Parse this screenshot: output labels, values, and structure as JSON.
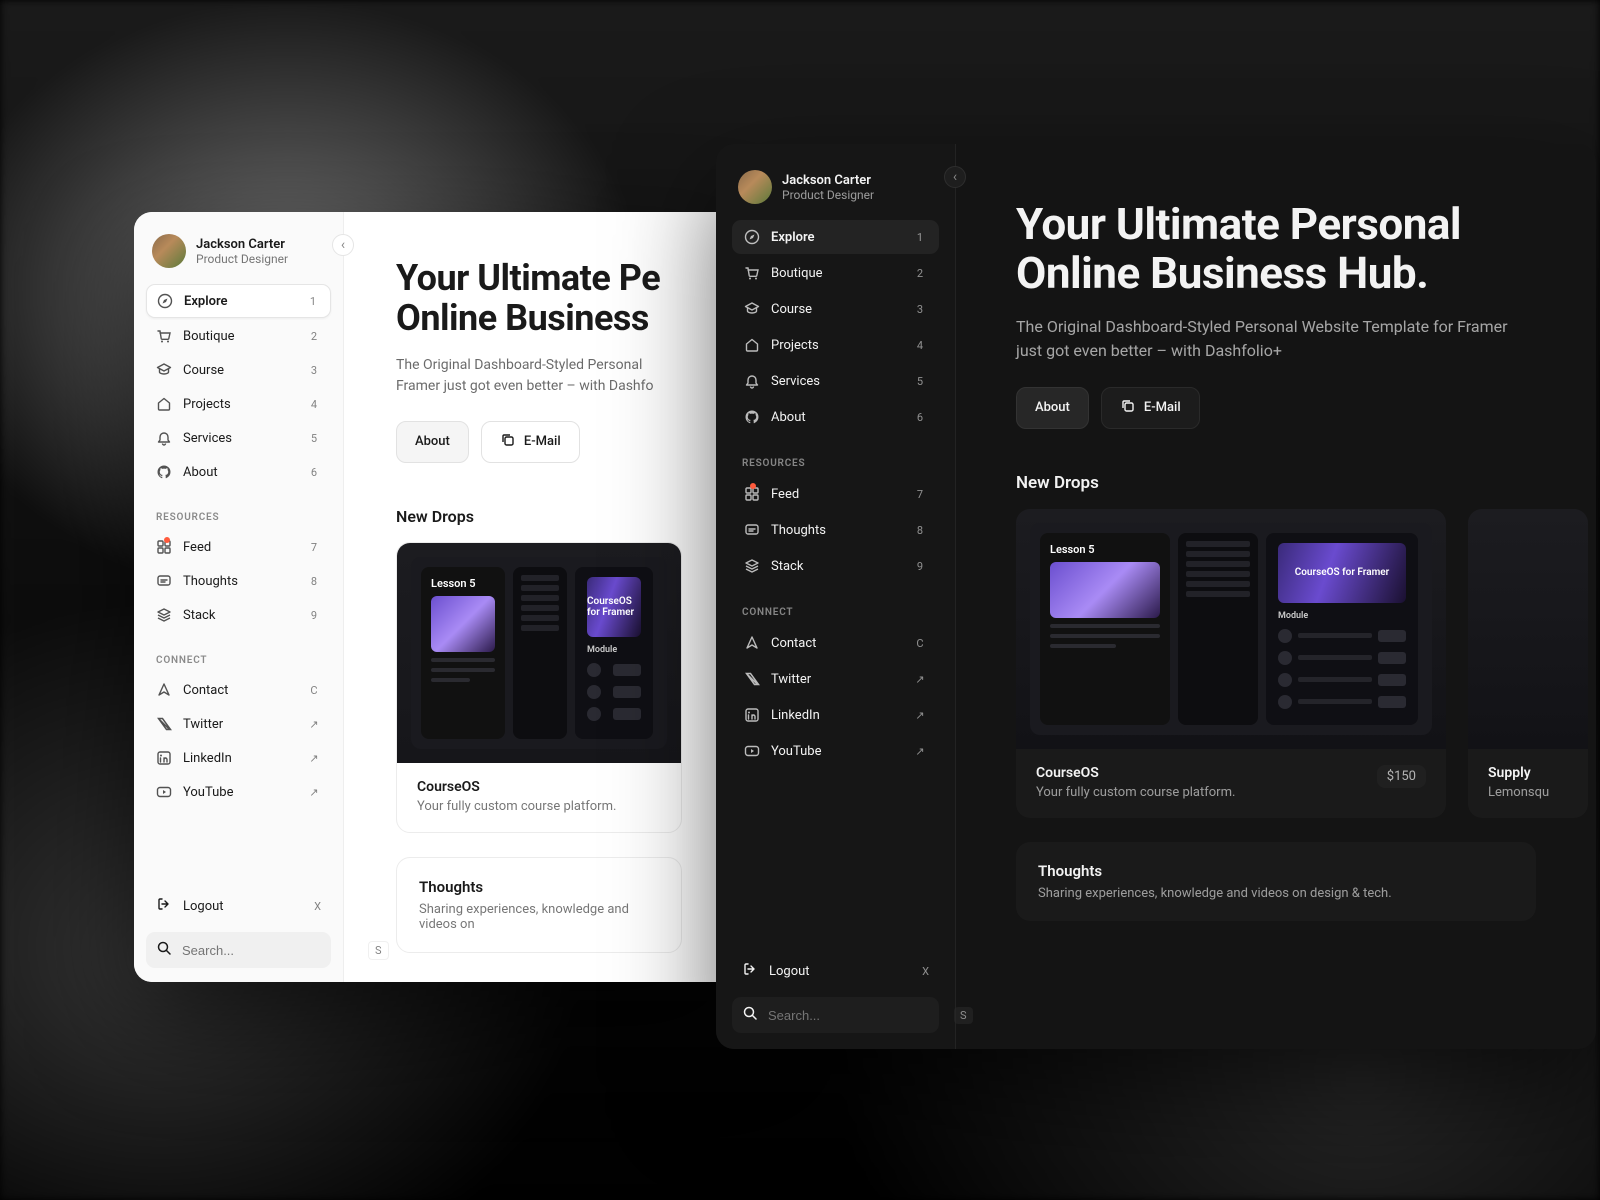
{
  "profile": {
    "name": "Jackson Carter",
    "role": "Product Designer"
  },
  "nav": {
    "main": [
      {
        "icon": "compass",
        "label": "Explore",
        "badge": "1",
        "active": true
      },
      {
        "icon": "cart",
        "label": "Boutique",
        "badge": "2"
      },
      {
        "icon": "grad",
        "label": "Course",
        "badge": "3"
      },
      {
        "icon": "home",
        "label": "Projects",
        "badge": "4"
      },
      {
        "icon": "bell",
        "label": "Services",
        "badge": "5"
      },
      {
        "icon": "github",
        "label": "About",
        "badge": "6"
      }
    ],
    "resources_label": "RESOURCES",
    "resources": [
      {
        "icon": "grid",
        "label": "Feed",
        "badge": "7",
        "dot": true
      },
      {
        "icon": "message",
        "label": "Thoughts",
        "badge": "8"
      },
      {
        "icon": "layers",
        "label": "Stack",
        "badge": "9"
      }
    ],
    "connect_label": "CONNECT",
    "connect": [
      {
        "icon": "send",
        "label": "Contact",
        "badge": "C"
      },
      {
        "icon": "x",
        "label": "Twitter",
        "badge": "↗"
      },
      {
        "icon": "linkedin",
        "label": "LinkedIn",
        "badge": "↗"
      },
      {
        "icon": "youtube",
        "label": "YouTube",
        "badge": "↗"
      }
    ]
  },
  "logout": {
    "label": "Logout",
    "badge": "X"
  },
  "search": {
    "placeholder": "Search...",
    "kbd": "S"
  },
  "hero": {
    "headline_light": "Your Ultimate Pe\nOnline Business",
    "headline_dark": "Your Ultimate Personal Online Business Hub.",
    "sub_light": "The Original Dashboard-Styled Personal \nFramer just got even better – with Dashfo",
    "sub_dark": "The Original Dashboard-Styled Personal Website Template for Framer just got even better – with Dashfolio+",
    "about": "About",
    "email": "E-Mail"
  },
  "drops": {
    "title": "New Drops",
    "mock_lesson": "Lesson 5",
    "mock_hero": "CourseOS for Framer",
    "mock_module": "Module",
    "card1": {
      "title": "CourseOS",
      "desc": "Your fully custom course platform.",
      "price": "$150"
    },
    "card2": {
      "title": "Supply",
      "desc": "Lemonsqu"
    }
  },
  "thoughts_light": {
    "title": "Thoughts",
    "desc": "Sharing experiences, knowledge and videos on "
  },
  "thoughts_dark": {
    "title": "Thoughts",
    "desc": "Sharing experiences, knowledge and videos on design & tech."
  }
}
